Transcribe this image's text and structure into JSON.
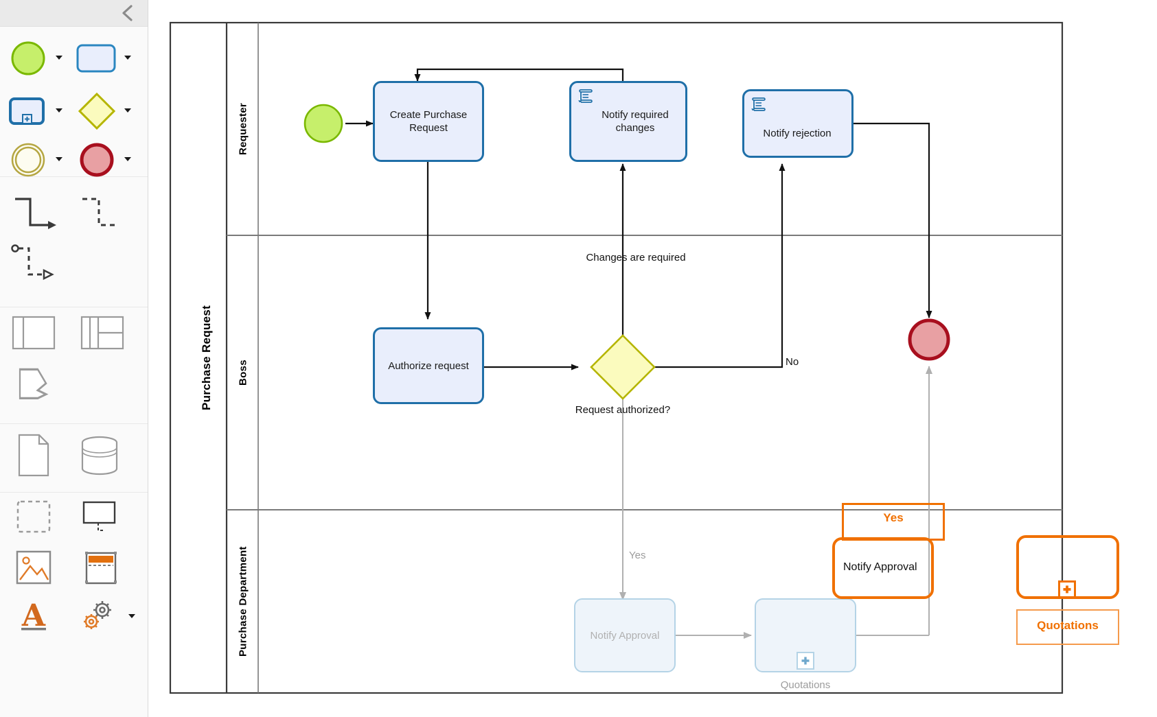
{
  "sidebar": {
    "collapse_icon": "chevron-left-icon",
    "groups": [
      {
        "name": "events-and-activities",
        "items": [
          {
            "icon": "start-event-circle-icon",
            "has_caret": true
          },
          {
            "icon": "task-rounded-rect-icon",
            "has_caret": true
          },
          {
            "icon": "subprocess-expanded-icon",
            "has_caret": true
          },
          {
            "icon": "gateway-diamond-icon",
            "has_caret": true
          },
          {
            "icon": "intermediate-event-double-circle-icon",
            "has_caret": true
          },
          {
            "icon": "end-event-circle-icon",
            "has_caret": true
          }
        ]
      },
      {
        "name": "connectors",
        "items": [
          {
            "icon": "sequence-flow-connector-icon",
            "has_caret": false
          },
          {
            "icon": "dashed-connector-icon",
            "has_caret": false
          },
          {
            "icon": "message-flow-connector-icon",
            "has_caret": false
          }
        ]
      },
      {
        "name": "pools-and-lanes",
        "items": [
          {
            "icon": "pool-icon",
            "has_caret": false
          },
          {
            "icon": "lane-grid-icon",
            "has_caret": false
          },
          {
            "icon": "data-object-icon",
            "has_caret": false
          }
        ]
      },
      {
        "name": "data",
        "items": [
          {
            "icon": "document-page-icon",
            "has_caret": false
          },
          {
            "icon": "data-store-cylinder-icon",
            "has_caret": false
          }
        ]
      },
      {
        "name": "annotations-and-media",
        "items": [
          {
            "icon": "dashed-group-box-icon",
            "has_caret": false
          },
          {
            "icon": "text-annotation-callout-icon",
            "has_caret": false
          },
          {
            "icon": "image-placeholder-icon",
            "has_caret": false
          },
          {
            "icon": "table-icon",
            "has_caret": false
          },
          {
            "icon": "text-tool-a-icon",
            "has_caret": false
          },
          {
            "icon": "gears-settings-icon",
            "has_caret": true
          }
        ]
      }
    ]
  },
  "diagram": {
    "pool": {
      "label": "Purchase Request"
    },
    "lanes": [
      {
        "id": "requester",
        "label": "Requester"
      },
      {
        "id": "boss",
        "label": "Boss"
      },
      {
        "id": "purchase_department",
        "label": "Purchase Department"
      }
    ],
    "nodes": [
      {
        "id": "start",
        "type": "start-event",
        "label": "",
        "lane": "requester"
      },
      {
        "id": "create_purchase_request",
        "type": "task",
        "label": "Create Purchase Request",
        "lane": "requester"
      },
      {
        "id": "notify_required_changes",
        "type": "script-task",
        "label": "Notify required changes",
        "lane": "requester"
      },
      {
        "id": "notify_rejection",
        "type": "script-task",
        "label": "Notify rejection",
        "lane": "requester"
      },
      {
        "id": "authorize_request",
        "type": "task",
        "label": "Authorize request",
        "lane": "boss"
      },
      {
        "id": "request_authorized",
        "type": "gateway",
        "label": "Request authorized?",
        "lane": "boss"
      },
      {
        "id": "end",
        "type": "end-event",
        "label": "",
        "lane": "boss"
      },
      {
        "id": "notify_approval_ghost",
        "type": "ghost-task",
        "label": "Notify Approval",
        "lane": "purchase_department"
      },
      {
        "id": "quotations_ghost",
        "type": "ghost-task",
        "label": "",
        "caption": "Quotations",
        "lane": "purchase_department"
      }
    ],
    "flow_labels": {
      "changes_required": "Changes are required",
      "no": "No",
      "yes_ghost": "Yes"
    }
  },
  "drag_overlay": {
    "yes_label": "Yes",
    "notify_approval_label": "Notify Approval",
    "quotations_label": "Quotations",
    "plus_icon": "plus-icon",
    "accent_color": "#f07000"
  },
  "colors": {
    "task_fill": "#e9eefc",
    "task_stroke": "#1f6fa8",
    "start_fill": "#c6ef6b",
    "start_stroke": "#7ab800",
    "gateway_fill": "#fbfbbe",
    "gateway_stroke": "#b5b500",
    "end_fill": "#e8a0a3",
    "end_stroke": "#a80f1e",
    "ghost_stroke": "#b4d3e6",
    "ghost_text": "#b0b0b0",
    "accent_orange": "#f07000"
  }
}
